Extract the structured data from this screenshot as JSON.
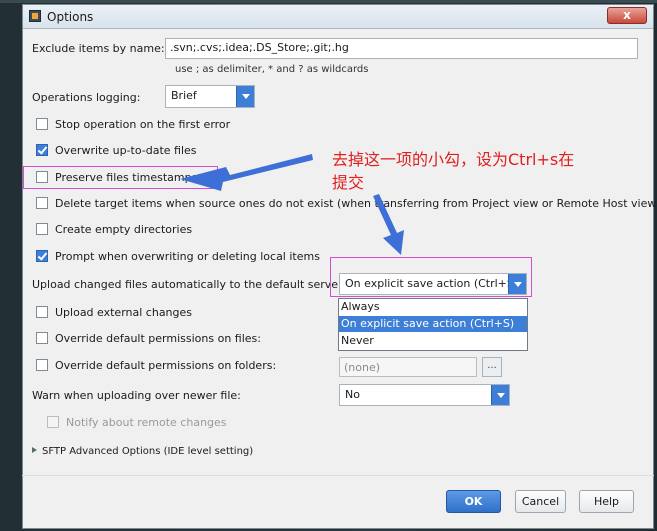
{
  "window": {
    "title": "Options",
    "close_label": "x"
  },
  "exclude": {
    "label": "Exclude items by name:",
    "value": ".svn;.cvs;.idea;.DS_Store;.git;.hg",
    "hint": "use ; as delimiter, * and ? as wildcards"
  },
  "operations_logging": {
    "label": "Operations logging:",
    "value": "Brief"
  },
  "checkboxes": [
    {
      "label": "Stop operation on the first error",
      "checked": false
    },
    {
      "label": "Overwrite up-to-date files",
      "checked": true
    },
    {
      "label": "Preserve files timestamps",
      "checked": false
    },
    {
      "label": "Delete target items when source ones do not exist (when transferring from Project view or Remote Host view)",
      "checked": false
    },
    {
      "label": "Create empty directories",
      "checked": false
    },
    {
      "label": "Prompt when overwriting or deleting local items",
      "checked": true
    }
  ],
  "upload_auto": {
    "label": "Upload changed files automatically to the default server",
    "value": "On explicit save action (Ctrl+S)",
    "options": [
      "Always",
      "On explicit save action (Ctrl+S)",
      "Never"
    ],
    "selected_index": 1
  },
  "upload_external": {
    "label": "Upload external changes",
    "checked": false
  },
  "override_files": {
    "label": "Override default permissions on files:",
    "checked": false
  },
  "override_folders": {
    "label": "Override default permissions on folders:",
    "checked": false,
    "value": "(none)",
    "browse_label": "..."
  },
  "warn_newer": {
    "label": "Warn when uploading over newer file:",
    "value": "No"
  },
  "notify_remote": {
    "label": "Notify about remote changes",
    "checked": false,
    "enabled": false
  },
  "sftp_advanced": {
    "label": "SFTP Advanced Options (IDE level setting)"
  },
  "buttons": {
    "ok": "OK",
    "cancel": "Cancel",
    "help": "Help"
  },
  "annotation": {
    "line1": "去掉这一项的小勾，设为Ctrl+s在",
    "line2": "提交",
    "color": "#e02020"
  },
  "colors": {
    "accent": "#3d7fd6",
    "highlight_box": "#d44ed0",
    "arrow": "#3d6fd6"
  }
}
